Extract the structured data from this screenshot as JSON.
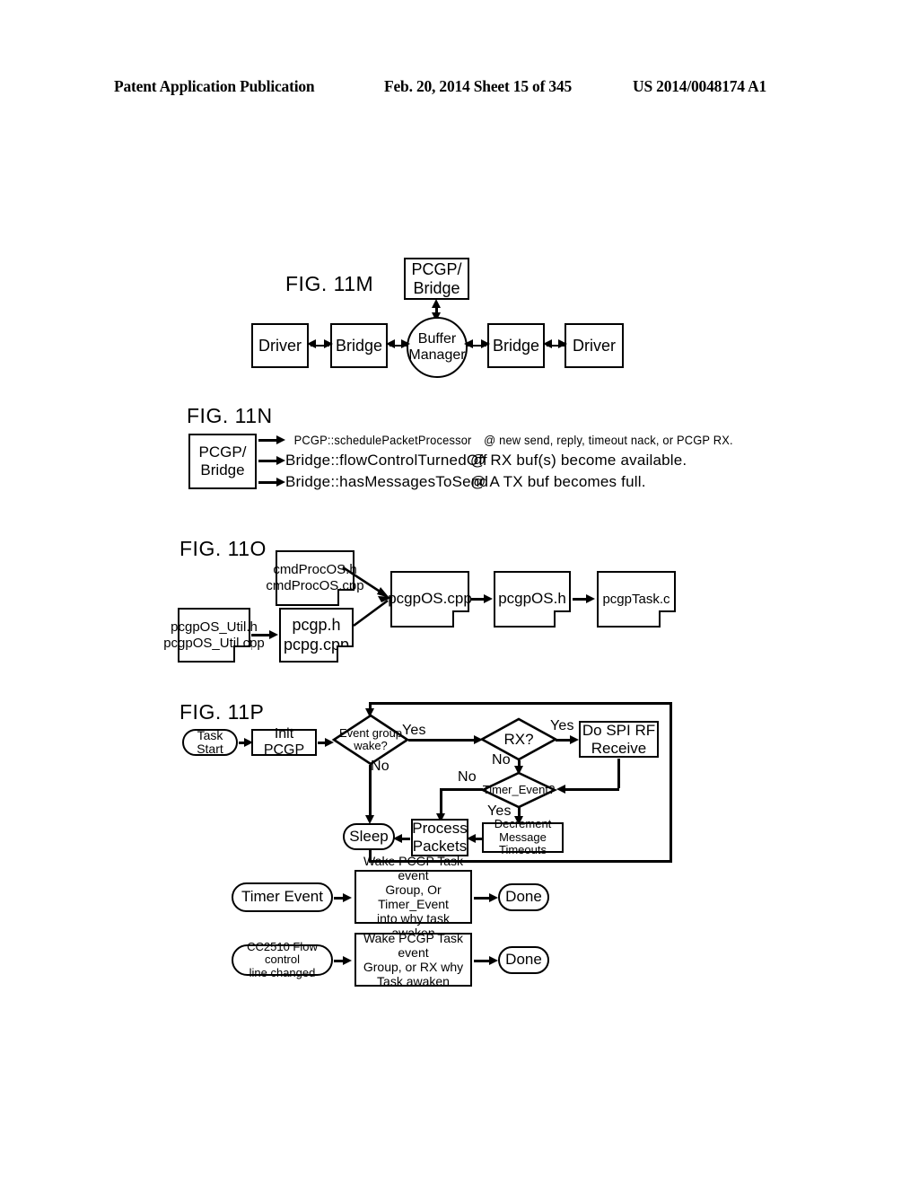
{
  "header": {
    "publication": "Patent Application Publication",
    "date_sheet": "Feb. 20, 2014  Sheet 15 of 345",
    "patent_number": "US 2014/0048174 A1"
  },
  "fig_11m": {
    "label": "FIG. 11M",
    "top_box": "PCGP/\nBridge",
    "top_box_line1": "PCGP/",
    "top_box_line2": "Bridge",
    "center": "Buffer\nManager",
    "center_line1": "Buffer",
    "center_line2": "Manager",
    "left_driver": "Driver",
    "left_bridge": "Bridge",
    "right_bridge": "Bridge",
    "right_driver": "Driver"
  },
  "fig_11n": {
    "label": "FIG. 11N",
    "source_line1": "PCGP/",
    "source_line2": "Bridge",
    "rows": [
      {
        "method": "PCGP::schedulePacketProcessor",
        "condition": "@ new send, reply, timeout nack, or PCGP RX."
      },
      {
        "method": "Bridge::flowControlTurnedOff",
        "condition": "@ RX buf(s) become available."
      },
      {
        "method": "Bridge::hasMessagesToSend",
        "condition": "@ A TX buf becomes full."
      }
    ]
  },
  "fig_11o": {
    "label": "FIG. 11O",
    "docs": {
      "cmdproc_l1": "cmdProcOS.h",
      "cmdproc_l2": "cmdProcOS.cpp",
      "util_l1": "pcgpOS_Util.h",
      "util_l2": "pcgpOS_Util.cpp",
      "pcgp_l1": "pcgp.h",
      "pcgp_l2": "pcpg.cpp",
      "pcgpos_cpp": "pcgpOS.cpp",
      "pcgpos_h": "pcgpOS.h",
      "pcgptask_c": "pcgpTask.c"
    }
  },
  "fig_11p": {
    "label": "FIG. 11P",
    "task_start": "Task Start",
    "init_pcgp": "Init PCGP",
    "event_group_l1": "Event group",
    "event_group_l2": "wake?",
    "rx": "RX?",
    "do_spi_l1": "Do SPI RF",
    "do_spi_l2": "Receive",
    "timer_event": "Timer_Event?",
    "decrement_l1": "Decrement",
    "decrement_l2": "Message Timeouts",
    "process_l1": "Process",
    "process_l2": "Packets",
    "sleep": "Sleep",
    "yes": "Yes",
    "no": "No",
    "handlers": [
      {
        "trigger_l1": "Timer Event",
        "trigger_l2": "",
        "action_l1": "Wake PCGP Task event",
        "action_l2": "Group, Or Timer_Event",
        "action_l3": "into why task awaken",
        "result": "Done"
      },
      {
        "trigger_l1": "CC2510 Flow control",
        "trigger_l2": "line changed",
        "action_l1": "Wake PCGP Task event",
        "action_l2": "Group, or RX why",
        "action_l3": "Task awaken",
        "result": "Done"
      }
    ]
  }
}
